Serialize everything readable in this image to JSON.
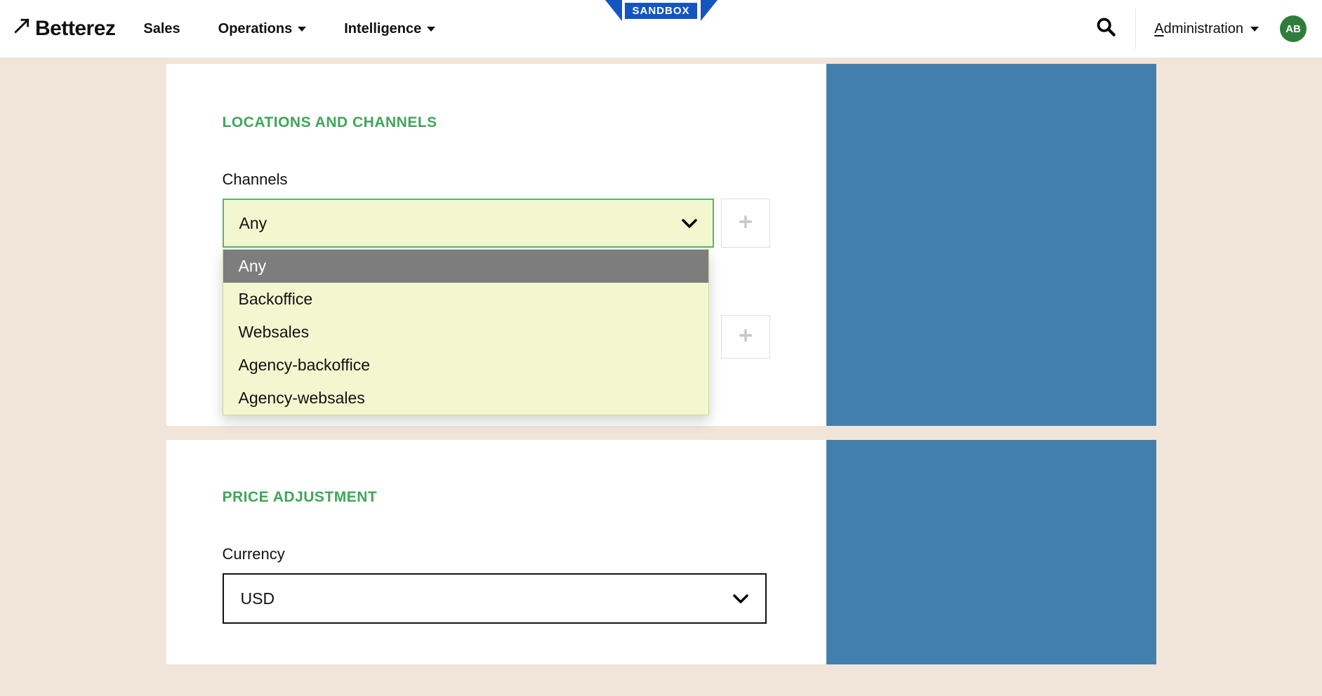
{
  "brand": "Betterez",
  "nav": {
    "sales": "Sales",
    "operations": "Operations",
    "intelligence": "Intelligence"
  },
  "sandbox_label": "SANDBOX",
  "admin": {
    "first_char": "A",
    "rest": "dministration"
  },
  "avatar_initials": "AB",
  "section1": {
    "title": "LOCATIONS AND CHANNELS",
    "channels_label": "Channels",
    "channels_value": "Any",
    "channels_options": {
      "o0": "Any",
      "o1": "Backoffice",
      "o2": "Websales",
      "o3": "Agency-backoffice",
      "o4": "Agency-websales"
    }
  },
  "section2": {
    "title": "PRICE ADJUSTMENT",
    "currency_label": "Currency",
    "currency_value": "USD"
  }
}
